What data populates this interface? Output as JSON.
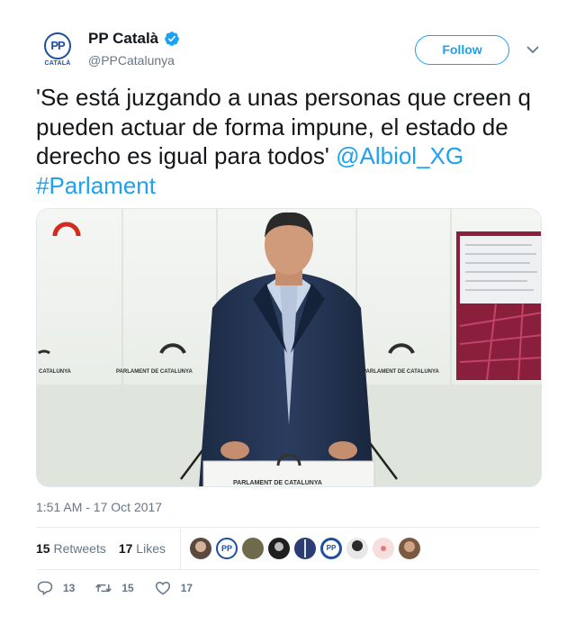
{
  "author": {
    "display_name": "PP Català",
    "handle": "@PPCatalunya",
    "verified": true,
    "avatar_text": "PP",
    "avatar_caption": "CATALÀ"
  },
  "follow_label": "Follow",
  "tweet": {
    "text": "'Se está juzgando a unas personas que creen q pueden actuar de forma impune, el estado de derecho es igual para todos'",
    "mention": "@Albiol_XG",
    "hashtag": "#Parlament"
  },
  "media": {
    "podium_text": "PARLAMENT DE CATALUNYA",
    "wall_text_left": "PARLAMENT DE CATALUNYA",
    "wall_text_right": "PARLAMENT DE CATALUNYA",
    "wall_text_far_left": "CATALUNYA"
  },
  "timestamp": "1:51 AM - 17 Oct 2017",
  "stats": {
    "retweets_count": "15",
    "retweets_label": "Retweets",
    "likes_count": "17",
    "likes_label": "Likes"
  },
  "liker_avatars": [
    "avatar-1",
    "avatar-pp",
    "avatar-3",
    "avatar-4",
    "avatar-5",
    "avatar-pp-2",
    "avatar-7",
    "avatar-8",
    "avatar-9"
  ],
  "actions": {
    "reply_count": "13",
    "retweet_count": "15",
    "like_count": "17"
  },
  "colors": {
    "accent": "#1da1f2",
    "pp_blue": "#1d4f9c",
    "secondary_text": "#657786"
  }
}
